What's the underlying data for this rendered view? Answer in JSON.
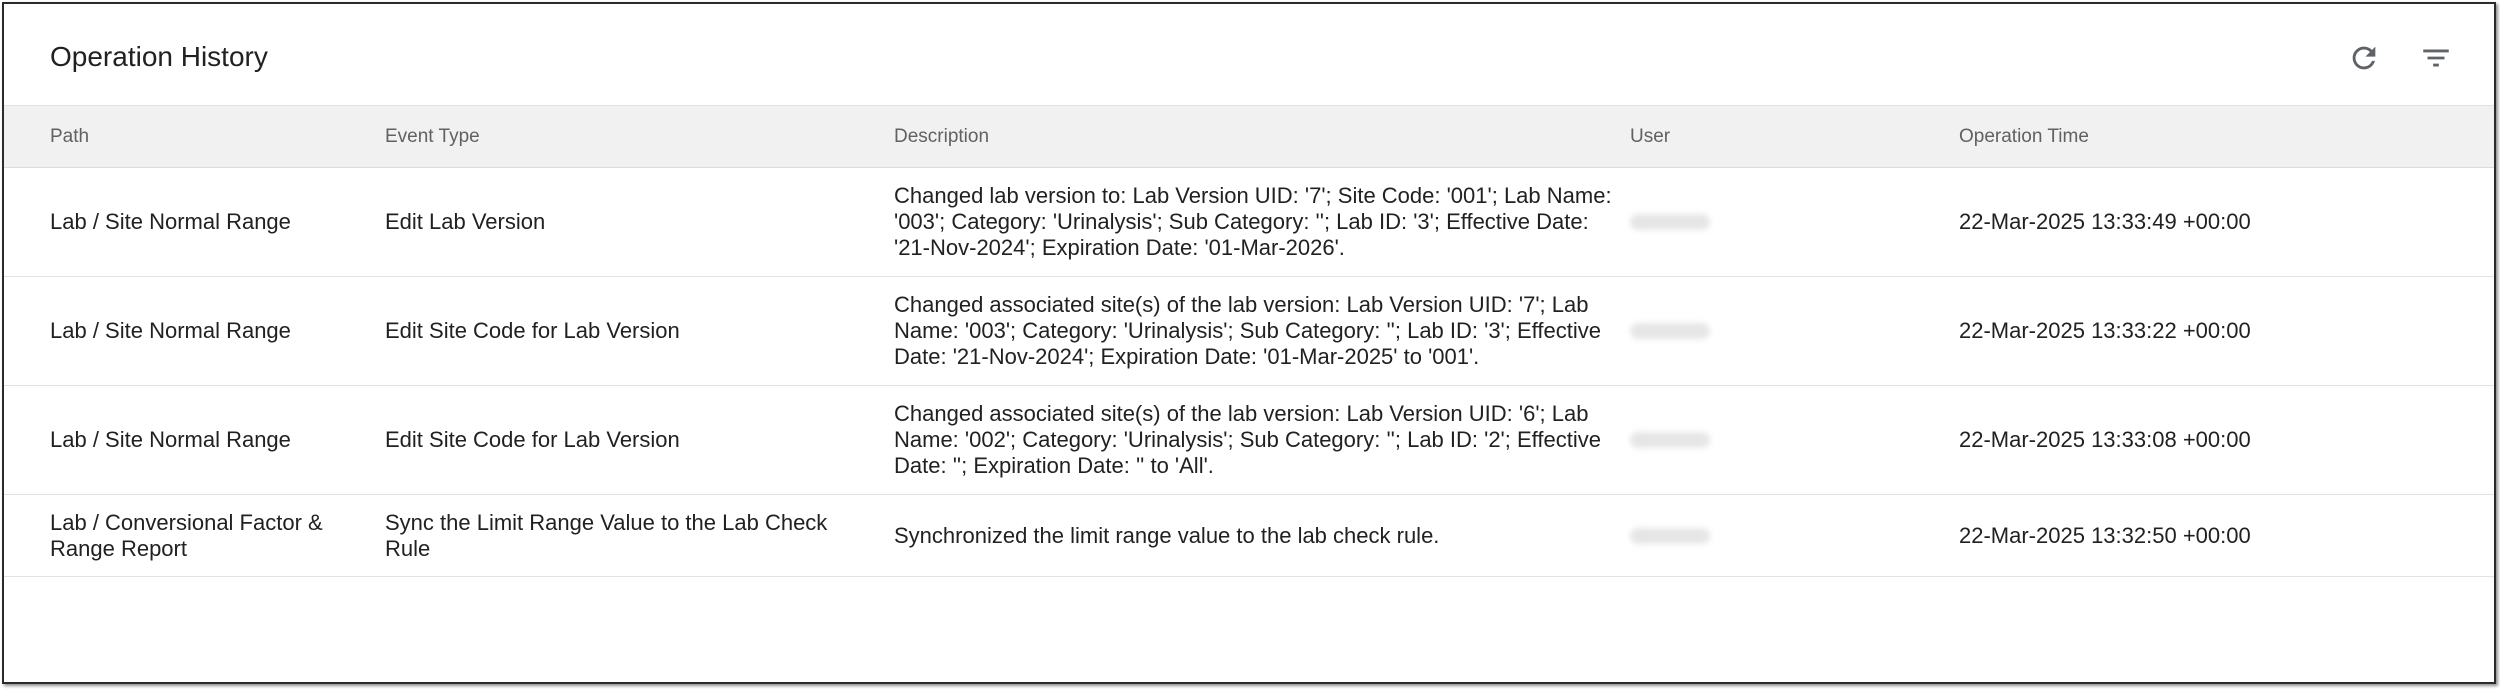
{
  "header": {
    "title": "Operation History",
    "refresh_icon": "refresh-icon",
    "filter_icon": "filter-icon"
  },
  "table": {
    "columns": [
      "Path",
      "Event Type",
      "Description",
      "User",
      "Operation Time"
    ],
    "rows": [
      {
        "path": "Lab / Site Normal Range",
        "event_type": "Edit Lab Version",
        "description": "Changed lab version to: Lab Version UID: '7'; Site Code: '001'; Lab Name: '003'; Category: 'Urinalysis'; Sub Category: ''; Lab ID: '3'; Effective Date: '21-Nov-2024'; Expiration Date: '01-Mar-2026'.",
        "operation_time": "22-Mar-2025 13:33:49 +00:00"
      },
      {
        "path": "Lab / Site Normal Range",
        "event_type": "Edit Site Code for Lab Version",
        "description": "Changed associated site(s) of the lab version: Lab Version UID: '7'; Lab Name: '003'; Category: 'Urinalysis'; Sub Category: ''; Lab ID: '3'; Effective Date: '21-Nov-2024'; Expiration Date: '01-Mar-2025' to '001'.",
        "operation_time": "22-Mar-2025 13:33:22 +00:00"
      },
      {
        "path": "Lab / Site Normal Range",
        "event_type": "Edit Site Code for Lab Version",
        "description": "Changed associated site(s) of the lab version: Lab Version UID: '6'; Lab Name: '002'; Category: 'Urinalysis'; Sub Category: ''; Lab ID: '2'; Effective Date: ''; Expiration Date: '' to 'All'.",
        "operation_time": "22-Mar-2025 13:33:08 +00:00"
      },
      {
        "path": "Lab / Conversional Factor & Range Report",
        "event_type": "Sync the Limit Range Value to the Lab Check Rule",
        "description": "Synchronized the limit range value to the lab check rule.",
        "operation_time": "22-Mar-2025 13:32:50 +00:00"
      }
    ]
  }
}
